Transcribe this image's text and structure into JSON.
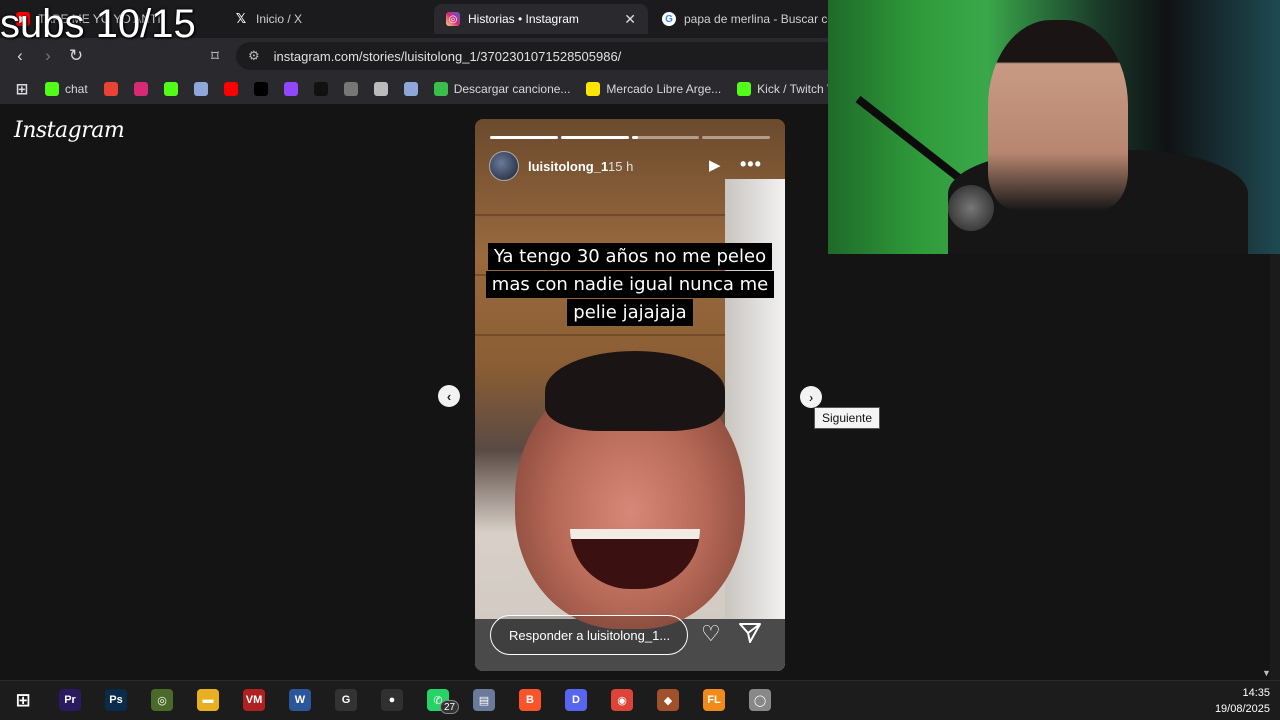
{
  "overlay": {
    "subs_counter": "subs 10/15"
  },
  "browser": {
    "tabs": [
      {
        "label": "TAPE ME YO YO ANTI",
        "icon": "youtube-icon",
        "color": "#ff0000"
      },
      {
        "label": "Inicio / X",
        "icon": "x-icon",
        "color": "#000000"
      },
      {
        "label": "Historias • Instagram",
        "icon": "instagram-icon",
        "color": "#d62976",
        "active": true
      },
      {
        "label": "papa de merlina - Buscar con",
        "icon": "google-icon",
        "color": "#4285f4"
      }
    ],
    "url": "instagram.com/stories/luisitolong_1/3702301071528505986/",
    "bookmarks": [
      {
        "label": "",
        "icon": "apps-grid-icon"
      },
      {
        "label": "chat",
        "icon": "kick-icon",
        "color": "#53fc18"
      },
      {
        "label": "",
        "icon": "gmail-icon",
        "color": "#ea4335"
      },
      {
        "label": "",
        "icon": "instagram-icon",
        "color": "#d62976"
      },
      {
        "label": "",
        "icon": "kick-icon",
        "color": "#53fc18"
      },
      {
        "label": "",
        "icon": "ethereum-icon",
        "color": "#8fa7d8"
      },
      {
        "label": "",
        "icon": "youtube-icon",
        "color": "#ff0000"
      },
      {
        "label": "",
        "icon": "x-icon",
        "color": "#000000"
      },
      {
        "label": "",
        "icon": "twitch-icon",
        "color": "#9146ff"
      },
      {
        "label": "",
        "icon": "tiktok-icon",
        "color": "#111111"
      },
      {
        "label": "",
        "icon": "openai-icon",
        "color": "#777777"
      },
      {
        "label": "",
        "icon": "image-icon",
        "color": "#bbbbbb"
      },
      {
        "label": "",
        "icon": "ethereum-icon",
        "color": "#8fa7d8"
      },
      {
        "label": "Descargar cancione...",
        "icon": "music-icon",
        "color": "#3ac04a"
      },
      {
        "label": "Mercado Libre Arge...",
        "icon": "mercadolibre-icon",
        "color": "#ffe600"
      },
      {
        "label": "Kick / Twitch VC",
        "icon": "kick-d-icon",
        "color": "#53fc18"
      }
    ]
  },
  "instagram": {
    "logo": "Instagram",
    "story": {
      "username": "luisitolong_1",
      "time_ago": "15 h",
      "caption": "Ya tengo 30 años no me peleo mas con nadie igual nunca me pelie jajajaja",
      "reply_placeholder": "Responder a luisitolong_1...",
      "segments_total": 4,
      "segments_done": 2,
      "current_segment_fraction": 0.1
    },
    "next_tooltip": "Siguiente"
  },
  "taskbar": {
    "icons": [
      {
        "name": "windows-start-icon",
        "label": "⊞",
        "color": "#0078d4"
      },
      {
        "name": "premiere-icon",
        "label": "Pr",
        "color": "#2a1a5e"
      },
      {
        "name": "photoshop-icon",
        "label": "Ps",
        "color": "#0b2b4a"
      },
      {
        "name": "app-target-icon",
        "label": "◎",
        "color": "#4a6a2a"
      },
      {
        "name": "file-explorer-icon",
        "label": "▬",
        "color": "#e8b020"
      },
      {
        "name": "voicemeeter-icon",
        "label": "VM",
        "color": "#b02020"
      },
      {
        "name": "word-icon",
        "label": "W",
        "color": "#2b579a"
      },
      {
        "name": "logitech-icon",
        "label": "G",
        "color": "#333333"
      },
      {
        "name": "obs-icon",
        "label": "●",
        "color": "#303030"
      },
      {
        "name": "whatsapp-icon",
        "label": "✆",
        "color": "#25d366"
      },
      {
        "name": "app-window-icon",
        "label": "▤",
        "color": "#6a7a9a"
      },
      {
        "name": "brave-icon",
        "label": "B",
        "color": "#fb542b"
      },
      {
        "name": "discord-icon",
        "label": "D",
        "color": "#5865f2"
      },
      {
        "name": "chrome-icon",
        "label": "◉",
        "color": "#db4437"
      },
      {
        "name": "app-game-icon",
        "label": "◆",
        "color": "#a0502a"
      },
      {
        "name": "fl-studio-icon",
        "label": "FL",
        "color": "#f08a1a"
      },
      {
        "name": "app-mouse-icon",
        "label": "◯",
        "color": "#888888"
      }
    ],
    "whatsapp_badge": "27",
    "time": "14:35",
    "date": "19/08/2025"
  }
}
